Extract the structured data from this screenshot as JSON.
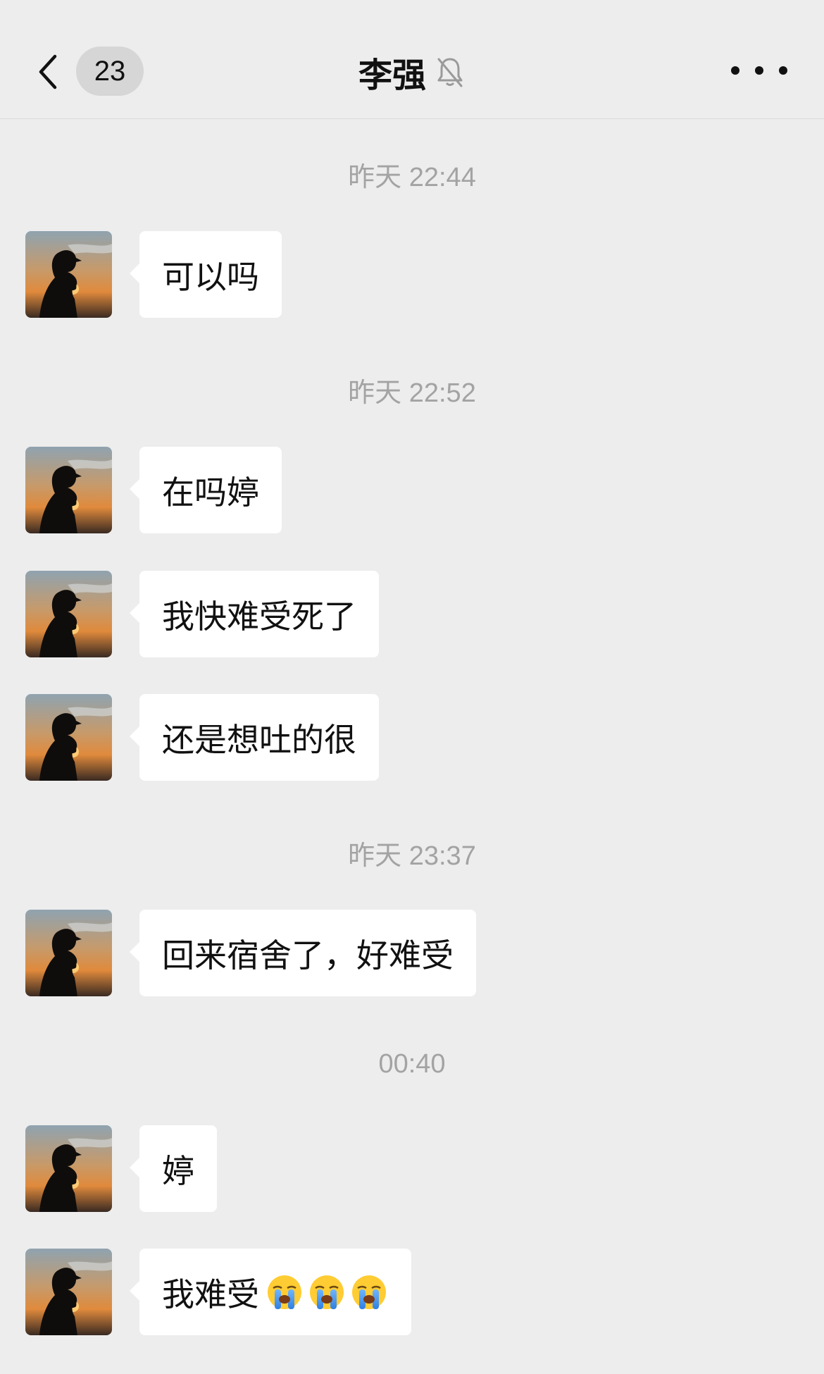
{
  "header": {
    "unread_count": "23",
    "title": "李强",
    "back_icon": "chevron-left-icon",
    "mute_icon": "bell-muted-icon",
    "more_icon": "more-dots-icon"
  },
  "timestamps": [
    "昨天 22:44",
    "昨天 22:52",
    "昨天 23:37",
    "00:40"
  ],
  "messages": [
    {
      "text": "可以吗"
    },
    {
      "text": "在吗婷"
    },
    {
      "text": "我快难受死了"
    },
    {
      "text": "还是想吐的很"
    },
    {
      "text": "回来宿舍了，好难受"
    },
    {
      "text": "婷"
    },
    {
      "text": "我难受",
      "emoji": [
        "crying-face",
        "crying-face",
        "crying-face"
      ]
    }
  ],
  "colors": {
    "background": "#ededed",
    "bubble": "#ffffff",
    "timestamp": "#a3a3a3"
  }
}
